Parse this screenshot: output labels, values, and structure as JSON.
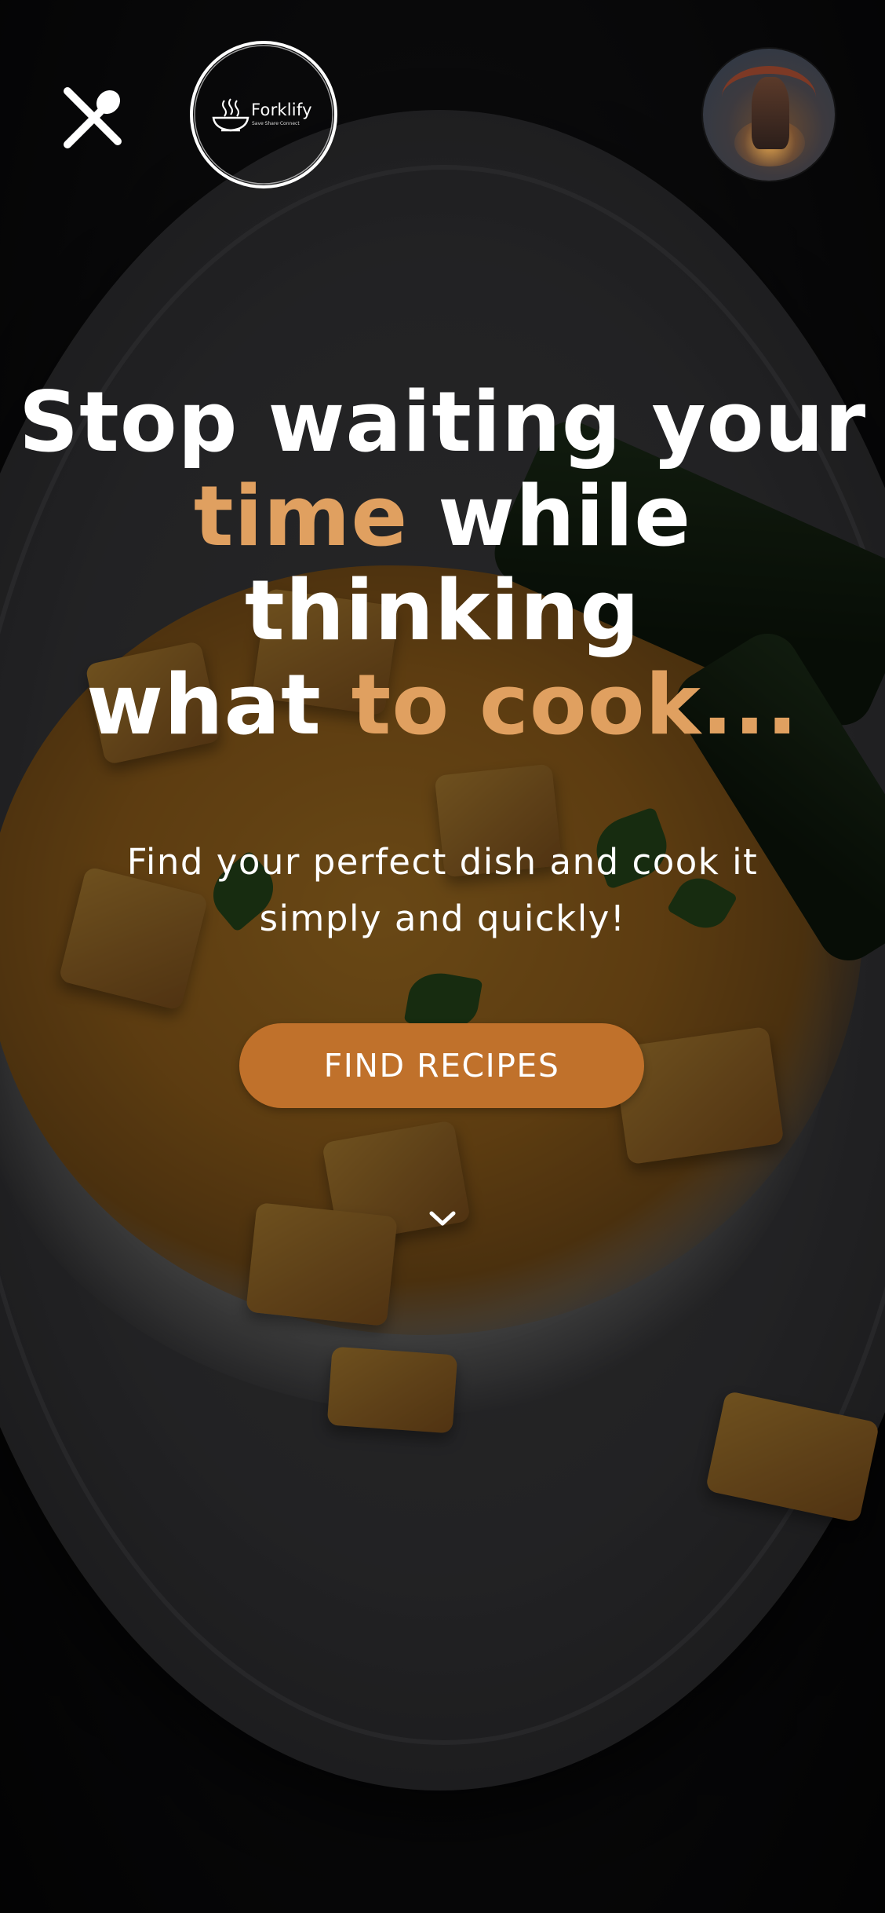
{
  "app": {
    "brand_name": "Forklify",
    "brand_tagline": "Save·Share·Connect"
  },
  "header": {
    "menu_icon": "fork-spoon-cross-icon",
    "logo_icon": "steaming-bowl-icon",
    "avatar_alt": "user-avatar"
  },
  "hero": {
    "title": {
      "line1": "Stop waiting your",
      "line2_accent": "time",
      "line2_rest": " while",
      "line3": "thinking",
      "line4_start": "what ",
      "line4_accent": "to cook..."
    },
    "subtitle": "Find your perfect dish and cook it simply and quickly!",
    "cta_label": "FIND RECIPES",
    "scroll_icon": "chevron-down-icon"
  },
  "colors": {
    "accent_text": "#e0a060",
    "button_bg": "#c0712b",
    "text": "#ffffff",
    "overlay": "rgba(0,0,0,0.48)"
  }
}
